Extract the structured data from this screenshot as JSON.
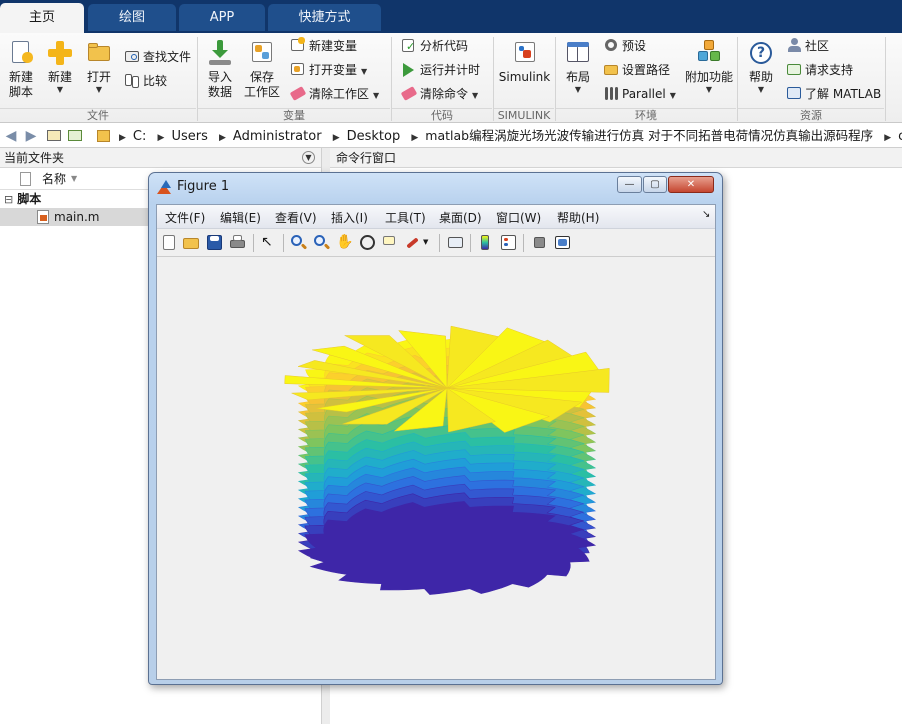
{
  "tabs": [
    {
      "label": "主页",
      "active": true
    },
    {
      "label": "绘图",
      "active": false
    },
    {
      "label": "APP",
      "active": false
    },
    {
      "label": "快捷方式",
      "active": false
    }
  ],
  "ribbon": {
    "file_group": {
      "label": "文件",
      "new_script": "新建\n脚本",
      "new_script_l1": "新建",
      "new_script_l2": "脚本",
      "new": "新建",
      "open": "打开",
      "find_files": "查找文件",
      "compare": "比较"
    },
    "variable_group": {
      "label": "变量",
      "import_l1": "导入",
      "import_l2": "数据",
      "save_l1": "保存",
      "save_l2": "工作区",
      "new_variable": "新建变量",
      "open_variable": "打开变量",
      "clear_workspace": "清除工作区"
    },
    "code_group": {
      "label": "代码",
      "analyze_code": "分析代码",
      "run_and_time": "运行并计时",
      "clear_commands": "清除命令"
    },
    "simulink_group": {
      "label": "SIMULINK",
      "simulink": "Simulink"
    },
    "environment_group": {
      "label": "环境",
      "layout": "布局",
      "preferences": "预设",
      "set_path": "设置路径",
      "parallel": "Parallel",
      "add_ons": "附加功能"
    },
    "resources_group": {
      "label": "资源",
      "help": "帮助",
      "community": "社区",
      "request_support": "请求支持",
      "learn_matlab": "了解 MATLAB"
    }
  },
  "address_bar": {
    "crumbs": [
      "C:",
      "Users",
      "Administrator",
      "Desktop",
      "matlab编程涡旋光场光波传输进行仿真 对于不同拓普电荷情况仿真输出源码程序",
      "code"
    ]
  },
  "current_folder": {
    "title": "当前文件夹",
    "column_name": "名称",
    "section": "脚本",
    "files": [
      "main.m"
    ]
  },
  "command_window": {
    "title": "命令行窗口"
  },
  "figure": {
    "title": "Figure 1",
    "menus": [
      "文件(F)",
      "编辑(E)",
      "查看(V)",
      "插入(I)",
      "工具(T)",
      "桌面(D)",
      "窗口(W)",
      "帮助(H)"
    ],
    "colors": {
      "colormap": [
        "#3e26a8",
        "#2f6ae0",
        "#1da8d7",
        "#2cc0a0",
        "#7bc560",
        "#c8bf40",
        "#fdc334",
        "#f9f615"
      ],
      "background": "#f0f0f0"
    },
    "plot": {
      "layers": 20,
      "blades": 18,
      "description_type": "stacked spiral surface"
    }
  },
  "icons": {
    "new_script": "new-script-icon",
    "new": "new-plus-icon",
    "open": "folder-open-icon",
    "import": "import-data-icon",
    "save_workspace": "save-workspace-icon",
    "simulink": "simulink-icon",
    "layout": "layout-icon",
    "add_ons": "add-ons-cubes-icon",
    "help": "help-question-icon"
  }
}
